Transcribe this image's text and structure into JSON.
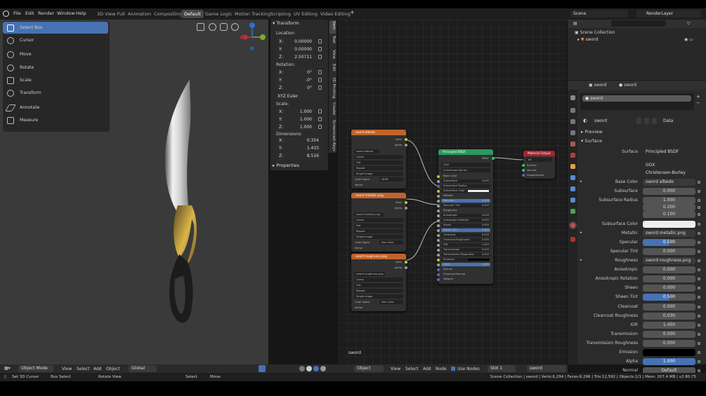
{
  "menu": {
    "file": "File",
    "edit": "Edit",
    "render": "Render",
    "window": "Window",
    "help": "Help"
  },
  "workspaces": [
    "3D View Full",
    "Animation",
    "Compositing",
    "Default",
    "Game Logic",
    "Motion Tracking",
    "Scripting",
    "UV Editing",
    "Video Editing"
  ],
  "active_workspace": "Default",
  "scene": {
    "label": "Scene",
    "render_layer": "RenderLayer"
  },
  "tools": [
    "Select Box",
    "Cursor",
    "Move",
    "Rotate",
    "Scale",
    "Transform",
    "Annotate",
    "Measure"
  ],
  "transform": {
    "title": "Transform",
    "location_label": "Location:",
    "location": [
      {
        "a": "X:",
        "v": "0.00000"
      },
      {
        "a": "Y:",
        "v": "0.00000"
      },
      {
        "a": "Z:",
        "v": "2.50711"
      }
    ],
    "rotation_label": "Rotation:",
    "rotation": [
      {
        "a": "X:",
        "v": "0°"
      },
      {
        "a": "Y:",
        "v": "-0°"
      },
      {
        "a": "Z:",
        "v": "0°"
      }
    ],
    "mode": "XYZ Euler",
    "scale_label": "Scale:",
    "scale": [
      {
        "a": "X:",
        "v": "1.000"
      },
      {
        "a": "Y:",
        "v": "1.000"
      },
      {
        "a": "Z:",
        "v": "1.000"
      }
    ],
    "dimensions_label": "Dimensions:",
    "dimensions": [
      {
        "a": "X:",
        "v": "0.354"
      },
      {
        "a": "Y:",
        "v": "1.433"
      },
      {
        "a": "Z:",
        "v": "8.516"
      }
    ],
    "properties": "Properties"
  },
  "side_tabs": [
    "Item",
    "Tool",
    "View",
    "Edit",
    "3D Printing",
    "Create",
    "Screencast Keys"
  ],
  "viewport_header": {
    "mode": "Object Mode",
    "view": "View",
    "select": "Select",
    "add": "Add",
    "object": "Object",
    "orientation": "Global"
  },
  "node_header": {
    "type": "Object",
    "view": "View",
    "select": "Select",
    "add": "Add",
    "node": "Node",
    "use_nodes": "Use Nodes",
    "slot": "Slot 1",
    "material": "sword"
  },
  "node_editor_label": "sword",
  "nodes": {
    "tex_albedo": {
      "title": "sword albedo",
      "image": "sword albedo",
      "rows": [
        "Linear",
        "Flat",
        "Repeat",
        "Single Image"
      ],
      "cs_label": "Color Space",
      "cs": "sRGB",
      "vector": "Vector",
      "out_color": "Color",
      "out_alpha": "Alpha"
    },
    "tex_metallic": {
      "title": "sword metallic.png",
      "image": "sword metallic.png",
      "rows": [
        "Linear",
        "Flat",
        "Repeat",
        "Single Image"
      ],
      "cs_label": "Color Space",
      "cs": "Non-Color",
      "vector": "Vector",
      "out_color": "Color",
      "out_alpha": "Alpha"
    },
    "tex_roughness": {
      "title": "sword roughness.png",
      "image": "sword roughness.png",
      "rows": [
        "Linear",
        "Flat",
        "Repeat",
        "Single Image"
      ],
      "cs_label": "Color Space",
      "cs": "Non-Color",
      "vector": "Vector",
      "out_color": "Color",
      "out_alpha": "Alpha"
    },
    "bsdf": {
      "title": "Principled BSDF",
      "out": "BSDF",
      "dist": "GGX",
      "sss": "Christensen-Burley",
      "inputs": [
        {
          "n": "Base Color",
          "v": ""
        },
        {
          "n": "Subsurface",
          "v": "0.000"
        },
        {
          "n": "Subsurface Radius",
          "v": ""
        },
        {
          "n": "Subsurface Color",
          "v": ""
        },
        {
          "n": "Metallic",
          "v": ""
        },
        {
          "n": "Specular",
          "v": "0.500"
        },
        {
          "n": "Specular Tint",
          "v": "0.000"
        },
        {
          "n": "Roughness",
          "v": ""
        },
        {
          "n": "Anisotropic",
          "v": "0.000"
        },
        {
          "n": "Anisotropic Rotation",
          "v": "0.000"
        },
        {
          "n": "Sheen",
          "v": "0.000"
        },
        {
          "n": "Sheen Tint",
          "v": "0.500"
        },
        {
          "n": "Clearcoat",
          "v": "0.000"
        },
        {
          "n": "Clearcoat Roughness",
          "v": "0.030"
        },
        {
          "n": "IOR",
          "v": "1.450"
        },
        {
          "n": "Transmission",
          "v": "0.000"
        },
        {
          "n": "Transmission Roughness",
          "v": "0.000"
        },
        {
          "n": "Emission",
          "v": ""
        },
        {
          "n": "Alpha",
          "v": "1.000"
        },
        {
          "n": "Normal",
          "v": ""
        },
        {
          "n": "Clearcoat Normal",
          "v": ""
        },
        {
          "n": "Tangent",
          "v": ""
        }
      ]
    },
    "output": {
      "title": "Material Output",
      "target": "All",
      "inputs": [
        "Surface",
        "Volume",
        "Displacement"
      ]
    }
  },
  "outliner": {
    "collection": "Scene Collection",
    "object": "sword"
  },
  "properties": {
    "header_object": "sword",
    "header_material": "sword",
    "slot": "sword",
    "material_name": "sword",
    "data_label": "Data",
    "preview": "Preview",
    "surface_section": "Surface",
    "surface_label": "Surface",
    "surface_value": "Principled BSDF",
    "distribution": "GGX",
    "subsurface_method": "Christensen-Burley",
    "rows": [
      {
        "n": "Base Color",
        "v": "sword albedo",
        "t": "link"
      },
      {
        "n": "Subsurface",
        "v": "0.000",
        "t": "num"
      },
      {
        "n": "Subsurface Radius",
        "v": "1.000",
        "t": "num"
      },
      {
        "n": "",
        "v": "0.200",
        "t": "num"
      },
      {
        "n": "",
        "v": "0.100",
        "t": "num"
      },
      {
        "n": "Subsurface Color",
        "v": "",
        "t": "white"
      },
      {
        "n": "Metallic",
        "v": "sword metallic.png",
        "t": "link"
      },
      {
        "n": "Specular",
        "v": "0.500",
        "t": "blue"
      },
      {
        "n": "Specular Tint",
        "v": "0.000",
        "t": "num"
      },
      {
        "n": "Roughness",
        "v": "sword roughness.png",
        "t": "link"
      },
      {
        "n": "Anisotropic",
        "v": "0.000",
        "t": "num"
      },
      {
        "n": "Anisotropic Rotation",
        "v": "0.000",
        "t": "num"
      },
      {
        "n": "Sheen",
        "v": "0.000",
        "t": "num"
      },
      {
        "n": "Sheen Tint",
        "v": "0.500",
        "t": "blue"
      },
      {
        "n": "Clearcoat",
        "v": "0.000",
        "t": "num"
      },
      {
        "n": "Clearcoat Roughness",
        "v": "0.030",
        "t": "num"
      },
      {
        "n": "IOR",
        "v": "1.450",
        "t": "num"
      },
      {
        "n": "Transmission",
        "v": "0.000",
        "t": "num"
      },
      {
        "n": "Transmission Roughness",
        "v": "0.000",
        "t": "num"
      },
      {
        "n": "Emission",
        "v": "",
        "t": "black"
      },
      {
        "n": "Alpha",
        "v": "1.000",
        "t": "blue"
      },
      {
        "n": "Normal",
        "v": "Default",
        "t": "num"
      }
    ]
  },
  "status": {
    "set_cursor": "Set 3D Cursor",
    "box_select": "Box Select",
    "rotate_view": "Rotate View",
    "select": "Select",
    "move": "Move",
    "stats": "Scene Collection | sword | Verts:6,294 | Faces:6,296 | Tris:12,592 | Objects:1/1 | Mem: 207.4 MB | v2.80.75"
  },
  "colors": {
    "accent": "#4772b3",
    "texture_node": "#c0632b",
    "shader_node": "#2b9a5c",
    "output_node": "#a5242d"
  }
}
